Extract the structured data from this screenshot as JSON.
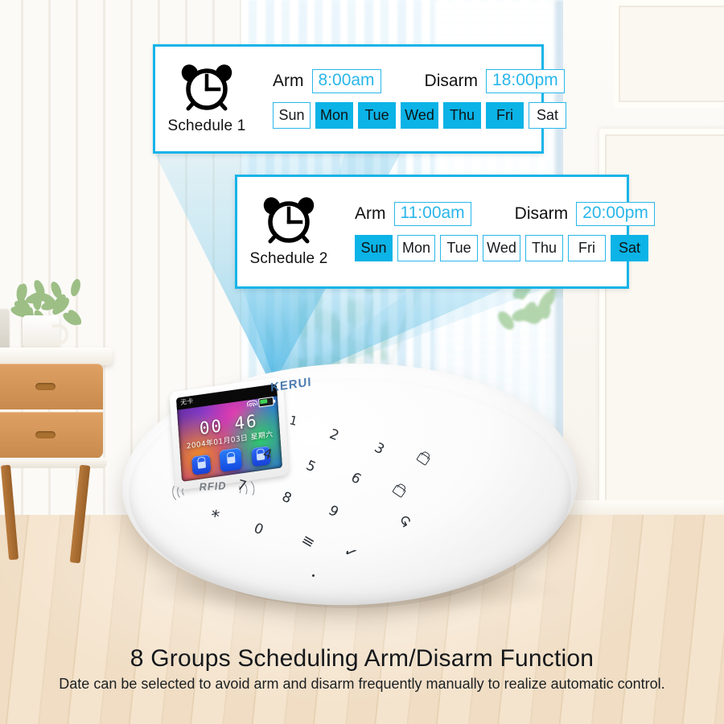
{
  "scene": {
    "brand_on_device": "KERUI",
    "rfid_label": "RFID",
    "device_screen": {
      "status_text_cn": "无卡",
      "time": "00 46",
      "date": "2004年01月03日 星期六",
      "wifi_icon": "wifi-icon",
      "battery_icon": "battery-icon",
      "app_icons": [
        "lock-closed-icon",
        "lock-open-icon",
        "lock-camera-icon"
      ]
    },
    "keypad": {
      "digits": [
        "1",
        "2",
        "3",
        "4",
        "5",
        "6",
        "7",
        "8",
        "9",
        "0"
      ],
      "star": "*",
      "menu": "≡",
      "confirm": "✓",
      "back": "↺",
      "arm_lock_icon": "lock-arm-icon",
      "disarm_lock_icon": "lock-disarm-icon"
    }
  },
  "schedules": [
    {
      "icon": "alarm-clock-icon",
      "label": "Schedule 1",
      "arm_label": "Arm",
      "arm_time": "8:00am",
      "disarm_label": "Disarm",
      "disarm_time": "18:00pm",
      "days": [
        {
          "name": "Sun",
          "selected": false
        },
        {
          "name": "Mon",
          "selected": true
        },
        {
          "name": "Tue",
          "selected": true
        },
        {
          "name": "Wed",
          "selected": true
        },
        {
          "name": "Thu",
          "selected": true
        },
        {
          "name": "Fri",
          "selected": true
        },
        {
          "name": "Sat",
          "selected": false
        }
      ]
    },
    {
      "icon": "alarm-clock-icon",
      "label": "Schedule 2",
      "arm_label": "Arm",
      "arm_time": "11:00am",
      "disarm_label": "Disarm",
      "disarm_time": "20:00pm",
      "days": [
        {
          "name": "Sun",
          "selected": true
        },
        {
          "name": "Mon",
          "selected": false
        },
        {
          "name": "Tue",
          "selected": false
        },
        {
          "name": "Wed",
          "selected": false
        },
        {
          "name": "Thu",
          "selected": false
        },
        {
          "name": "Fri",
          "selected": false
        },
        {
          "name": "Sat",
          "selected": true
        }
      ]
    }
  ],
  "caption": {
    "headline": "8 Groups Scheduling Arm/Disarm Function",
    "subline": "Date can be selected to avoid arm and disarm frequently manually to realize automatic control."
  },
  "colors": {
    "accent_cyan": "#16b4e8",
    "day_selected_fill": "#0cb3e6",
    "time_text": "#29b6ea",
    "beam_blue": "#5bbfe8"
  }
}
